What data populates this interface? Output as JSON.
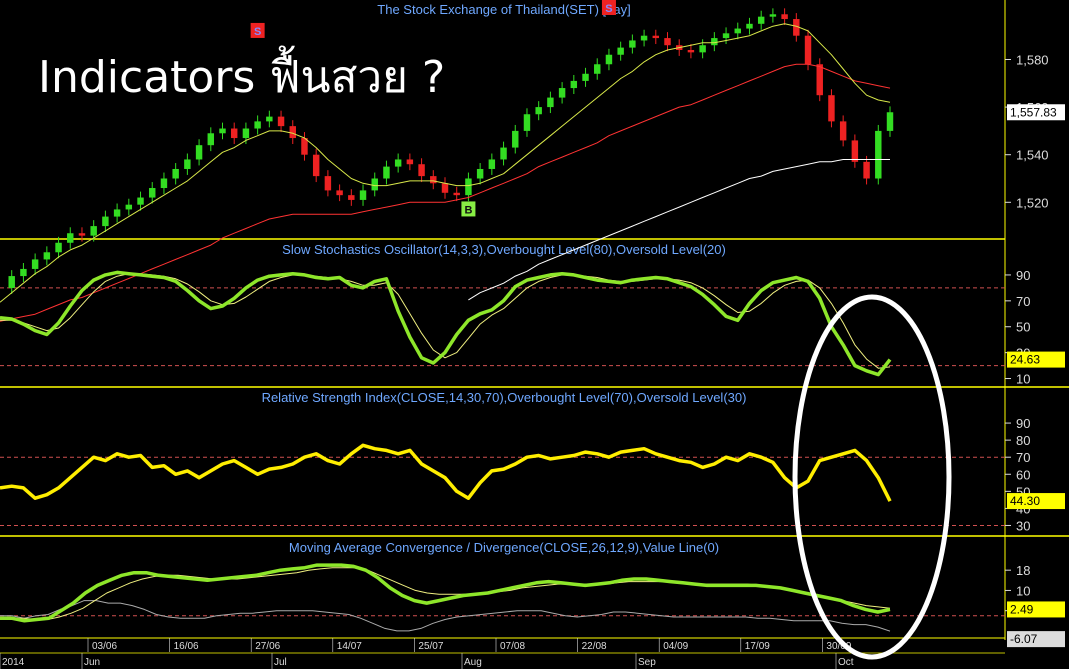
{
  "header": {
    "headline": "Indicators ฟื้นสวย ?",
    "price_title": "The Stock Exchange of Thailand(SET) [day]"
  },
  "colors": {
    "background": "#000000",
    "up_candle": "#33dd22",
    "down_candle": "#ee2222",
    "sma_short": "#d8e84a",
    "sma_mid": "#ff3333",
    "sma_long": "#ffffff",
    "stoch_k": "#8ee62a",
    "stoch_d": "#f0f080",
    "rsi": "#ffee00",
    "macd": "#8ee62a",
    "signal": "#f0f080",
    "histogram": "#aaaaaa",
    "level_line": "#d05050",
    "panel_border": "#ffff00",
    "annotation_ellipse": "#ffffff"
  },
  "chart_data": [
    {
      "type": "candlestick",
      "title": "The Stock Exchange of Thailand(SET) [day]",
      "ylim": [
        1505,
        1605
      ],
      "y_ticks": [
        "1,520",
        "1,540",
        "1,560",
        "1,580"
      ],
      "last_value_label": "1,557.83",
      "x_date_ticks": [
        "03/06",
        "16/06",
        "27/06",
        "14/07",
        "25/07",
        "07/08",
        "22/08",
        "04/09",
        "17/09",
        "30/09"
      ],
      "x_month_labels": [
        "2014",
        "Jun",
        "Jul",
        "Aug",
        "Sep",
        "Oct"
      ],
      "signals": [
        {
          "label": "S",
          "color": "#ee2222",
          "text_color": "#8888ff",
          "index": 22,
          "price": 1592
        },
        {
          "label": "B",
          "color": "#88ee44",
          "text_color": "#111111",
          "index": 40,
          "price": 1517
        },
        {
          "label": "S",
          "color": "#ee2222",
          "text_color": "#8888ff",
          "index": 52,
          "price": 1608
        }
      ],
      "close": [
        1484,
        1489,
        1492,
        1496,
        1499,
        1503,
        1507,
        1506,
        1510,
        1514,
        1517,
        1519,
        1522,
        1526,
        1530,
        1534,
        1538,
        1544,
        1549,
        1551,
        1547,
        1551,
        1554,
        1556,
        1552,
        1547,
        1540,
        1531,
        1525,
        1523,
        1521,
        1525,
        1530,
        1535,
        1538,
        1536,
        1531,
        1528,
        1524,
        1523,
        1530,
        1534,
        1538,
        1543,
        1550,
        1557,
        1560,
        1564,
        1568,
        1571,
        1574,
        1578,
        1582,
        1585,
        1588,
        1590,
        1589,
        1586,
        1584,
        1583,
        1586,
        1589,
        1591,
        1593,
        1595,
        1598,
        1599,
        1597,
        1590,
        1578,
        1565,
        1554,
        1546,
        1537,
        1530,
        1550,
        1557.83
      ],
      "sma_short": [
        1478,
        1482,
        1486,
        1490,
        1493,
        1497,
        1500,
        1502,
        1505,
        1508,
        1511,
        1514,
        1517,
        1520,
        1523,
        1526,
        1529,
        1533,
        1537,
        1541,
        1543,
        1546,
        1548,
        1550,
        1550,
        1549,
        1547,
        1543,
        1538,
        1534,
        1530,
        1528,
        1527,
        1527,
        1528,
        1529,
        1529,
        1529,
        1528,
        1527,
        1527,
        1528,
        1530,
        1532,
        1536,
        1540,
        1544,
        1548,
        1552,
        1556,
        1560,
        1564,
        1568,
        1572,
        1575,
        1579,
        1582,
        1584,
        1585,
        1586,
        1587,
        1587,
        1588,
        1589,
        1590,
        1592,
        1594,
        1595,
        1594,
        1592,
        1587,
        1582,
        1576,
        1570,
        1565,
        1563,
        1562
      ],
      "sma_mid": [
        1470,
        1471,
        1472,
        1473,
        1475,
        1477,
        1479,
        1480,
        1482,
        1484,
        1486,
        1488,
        1490,
        1492,
        1494,
        1496,
        1498,
        1500,
        1502,
        1505,
        1507,
        1509,
        1511,
        1513,
        1514,
        1515,
        1515,
        1515,
        1515,
        1515,
        1515,
        1516,
        1517,
        1518,
        1519,
        1520,
        1520,
        1520,
        1520,
        1521,
        1522,
        1524,
        1526,
        1528,
        1530,
        1532,
        1535,
        1537,
        1539,
        1541,
        1543,
        1545,
        1548,
        1550,
        1552,
        1554,
        1556,
        1558,
        1560,
        1561,
        1563,
        1565,
        1567,
        1569,
        1571,
        1573,
        1575,
        1577,
        1578,
        1578,
        1577,
        1575,
        1573,
        1571,
        1570,
        1569,
        1568
      ],
      "sma_long": [
        null,
        null,
        null,
        null,
        null,
        null,
        null,
        null,
        null,
        null,
        null,
        null,
        null,
        null,
        null,
        null,
        null,
        null,
        null,
        null,
        null,
        null,
        null,
        null,
        null,
        null,
        null,
        null,
        null,
        null,
        null,
        null,
        null,
        null,
        null,
        null,
        null,
        null,
        null,
        null,
        1479,
        1482,
        1484,
        1486,
        1489,
        1491,
        1494,
        1496,
        1498,
        1500,
        1502,
        1504,
        1506,
        1508,
        1510,
        1512,
        1514,
        1516,
        1518,
        1520,
        1522,
        1524,
        1526,
        1528,
        1530,
        1531,
        1533,
        1534,
        1535,
        1536,
        1537,
        1537,
        1538,
        1538,
        1538,
        1538,
        1538
      ]
    },
    {
      "type": "line",
      "title": "Slow Stochastics Oscillator(14,3,3),Overbought Level(80),Oversold Level(20)",
      "ylim": [
        5,
        100
      ],
      "y_ticks": [
        10,
        30,
        50,
        70,
        90
      ],
      "levels": [
        80,
        20
      ],
      "last_value_label": "24.63",
      "series": [
        {
          "name": "%K",
          "values": [
            57,
            56,
            52,
            47,
            44,
            53,
            66,
            78,
            86,
            90,
            92,
            91,
            90,
            89,
            88,
            85,
            78,
            70,
            64,
            66,
            72,
            80,
            86,
            89,
            90,
            91,
            90,
            88,
            87,
            88,
            82,
            80,
            85,
            87,
            62,
            42,
            26,
            22,
            30,
            44,
            55,
            60,
            63,
            70,
            81,
            86,
            88,
            90,
            91,
            90,
            88,
            86,
            85,
            84,
            86,
            87,
            88,
            87,
            84,
            81,
            75,
            67,
            58,
            55,
            68,
            78,
            84,
            86,
            88,
            85,
            72,
            50,
            36,
            20,
            16,
            13,
            24.63
          ]
        },
        {
          "name": "%D",
          "values": [
            55,
            55,
            53,
            50,
            47,
            49,
            57,
            67,
            77,
            85,
            89,
            91,
            91,
            90,
            89,
            87,
            83,
            77,
            70,
            67,
            68,
            73,
            79,
            85,
            88,
            90,
            90,
            89,
            88,
            87,
            85,
            82,
            82,
            84,
            75,
            60,
            45,
            32,
            26,
            30,
            41,
            52,
            59,
            64,
            72,
            80,
            85,
            88,
            90,
            90,
            89,
            88,
            86,
            85,
            85,
            86,
            87,
            87,
            86,
            84,
            80,
            74,
            67,
            61,
            62,
            68,
            76,
            82,
            85,
            86,
            80,
            68,
            53,
            36,
            25,
            18,
            19
          ]
        }
      ]
    },
    {
      "type": "line",
      "title": "Relative Strength Index(CLOSE,14,30,70),Overbought Level(70),Oversold Level(30)",
      "ylim": [
        25,
        100
      ],
      "y_ticks": [
        30,
        40,
        50,
        60,
        70,
        80,
        90
      ],
      "levels": [
        70,
        30
      ],
      "last_value_label": "44.30",
      "series": [
        {
          "name": "RSI",
          "values": [
            52,
            53,
            52,
            46,
            48,
            52,
            58,
            64,
            70,
            68,
            72,
            70,
            71,
            64,
            65,
            60,
            62,
            58,
            62,
            66,
            68,
            64,
            60,
            63,
            64,
            66,
            70,
            72,
            68,
            66,
            72,
            77,
            75,
            74,
            72,
            74,
            66,
            62,
            58,
            50,
            46,
            55,
            62,
            63,
            66,
            70,
            71,
            69,
            70,
            71,
            73,
            72,
            70,
            73,
            74,
            75,
            72,
            70,
            68,
            67,
            64,
            66,
            70,
            68,
            72,
            70,
            67,
            58,
            52,
            56,
            68,
            70,
            72,
            74,
            68,
            58,
            44.3
          ]
        }
      ]
    },
    {
      "type": "line",
      "title": "Moving Average Convergence / Divergence(CLOSE,26,12,9),Value Line(0)",
      "ylim": [
        -8,
        24
      ],
      "y_ticks": [
        2,
        10,
        18
      ],
      "levels": [
        0
      ],
      "last_value_labels": [
        "2.49",
        "-6.07"
      ],
      "series": [
        {
          "name": "MACD",
          "values": [
            -1,
            -1,
            -2,
            -1.5,
            -1,
            2,
            5,
            9,
            12,
            14,
            16,
            17,
            17,
            16,
            15.5,
            15,
            14.5,
            14,
            14.5,
            15,
            15.5,
            16,
            17,
            18,
            18.5,
            19,
            20,
            20,
            20,
            19.5,
            18,
            15,
            11,
            8,
            6,
            5,
            6,
            7,
            8,
            8.5,
            9,
            10,
            11,
            12,
            13,
            13.5,
            13,
            12.5,
            12,
            12.5,
            13,
            14,
            14.5,
            14.5,
            14,
            13.5,
            13,
            12.5,
            12,
            12,
            12,
            12,
            12,
            11.5,
            11,
            10,
            9,
            8,
            7,
            6,
            4,
            2.5,
            1.5,
            2.49
          ]
        },
        {
          "name": "Signal",
          "values": [
            -1,
            -1,
            -1,
            -1.5,
            -1.5,
            -0.5,
            1,
            3,
            6,
            9,
            11,
            13,
            14.5,
            15.5,
            16,
            16,
            15.5,
            15,
            14.5,
            14.5,
            14.5,
            15,
            15.5,
            16,
            16.5,
            17,
            18,
            18.5,
            19,
            19,
            19,
            18,
            16,
            14,
            12,
            10,
            9,
            8.5,
            8.5,
            8.5,
            8.5,
            9,
            9.5,
            10,
            11,
            11.5,
            12,
            12.5,
            12.5,
            12.5,
            12.5,
            12.5,
            13,
            13.5,
            13.5,
            13.5,
            13.5,
            13,
            12.5,
            12.5,
            12.5,
            12.5,
            12.5,
            12.5,
            12,
            11.5,
            11,
            10,
            9,
            8,
            7,
            6,
            5,
            4,
            3.5,
            3
          ]
        },
        {
          "name": "Histogram",
          "values": [
            0,
            0,
            -1,
            0,
            0.5,
            2.5,
            4,
            6,
            6,
            5,
            5,
            4,
            2.5,
            0.5,
            -0.5,
            -1,
            -1,
            -1,
            0,
            0.5,
            1,
            1,
            1.5,
            2,
            2,
            2,
            2,
            1.5,
            1,
            0.5,
            -1,
            -3,
            -5,
            -6,
            -6,
            -5,
            -3,
            -1.5,
            -0.5,
            0,
            0.5,
            1,
            1.5,
            2,
            2,
            2,
            1,
            0,
            -0.5,
            0,
            0.5,
            1.5,
            1.5,
            1,
            0.5,
            0,
            -0.5,
            -0.5,
            -0.5,
            -0.5,
            -0.5,
            -0.5,
            -0.5,
            -1,
            -1,
            -1.5,
            -2,
            -2,
            -2,
            -2,
            -3,
            -3.5,
            -3.5,
            -4.5,
            -6.07
          ]
        }
      ]
    }
  ]
}
